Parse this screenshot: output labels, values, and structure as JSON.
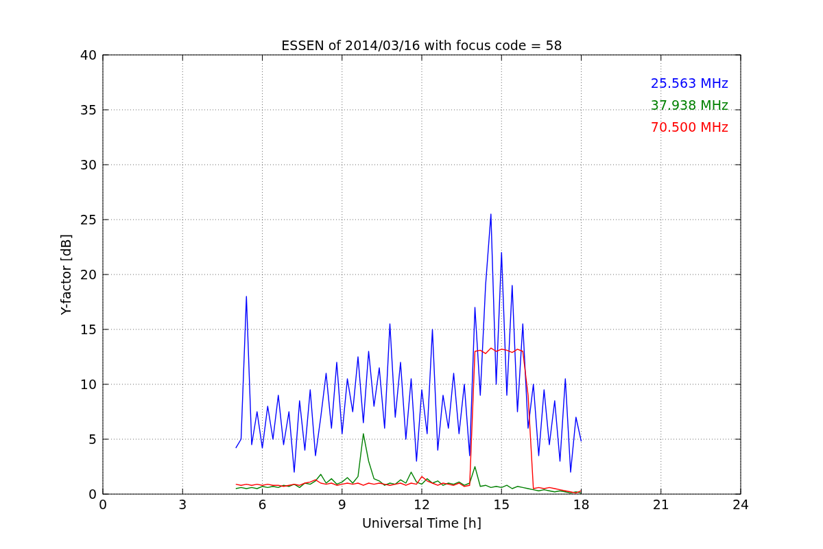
{
  "chart_data": {
    "type": "line",
    "title": "ESSEN of 2014/03/16 with focus code = 58",
    "xlabel": "Universal Time [h]",
    "ylabel": "Y-factor [dB]",
    "x": [
      5.0,
      5.2,
      5.4,
      5.6,
      5.8,
      6.0,
      6.2,
      6.4,
      6.6,
      6.8,
      7.0,
      7.2,
      7.4,
      7.6,
      7.8,
      8.0,
      8.2,
      8.4,
      8.6,
      8.8,
      9.0,
      9.2,
      9.4,
      9.6,
      9.8,
      10.0,
      10.2,
      10.4,
      10.6,
      10.8,
      11.0,
      11.2,
      11.4,
      11.6,
      11.8,
      12.0,
      12.2,
      12.4,
      12.6,
      12.8,
      13.0,
      13.2,
      13.4,
      13.6,
      13.8,
      14.0,
      14.2,
      14.4,
      14.6,
      14.8,
      15.0,
      15.2,
      15.4,
      15.6,
      15.8,
      16.0,
      16.2,
      16.4,
      16.6,
      16.8,
      17.0,
      17.2,
      17.4,
      17.6,
      17.8,
      18.0
    ],
    "series": [
      {
        "name": "25.563 MHz",
        "color": "#0000ff",
        "values": [
          4.2,
          5.0,
          18.0,
          4.5,
          7.5,
          4.2,
          8.0,
          5.0,
          9.0,
          4.5,
          7.5,
          2.0,
          8.5,
          4.0,
          9.5,
          3.5,
          7.0,
          11.0,
          6.0,
          12.0,
          5.5,
          10.5,
          7.5,
          12.5,
          6.5,
          13.0,
          8.0,
          11.5,
          6.0,
          15.5,
          7.0,
          12.0,
          5.0,
          10.5,
          3.0,
          9.5,
          5.5,
          15.0,
          4.0,
          9.0,
          6.0,
          11.0,
          5.5,
          10.0,
          3.5,
          17.0,
          9.0,
          19.0,
          25.5,
          10.0,
          22.0,
          9.0,
          19.0,
          7.5,
          15.5,
          6.0,
          10.0,
          3.5,
          9.5,
          4.5,
          8.5,
          3.0,
          10.5,
          2.0,
          7.0,
          4.8
        ]
      },
      {
        "name": "37.938 MHz",
        "color": "#008000",
        "values": [
          0.5,
          0.6,
          0.5,
          0.6,
          0.5,
          0.7,
          0.6,
          0.7,
          0.6,
          0.8,
          0.7,
          0.9,
          0.6,
          1.0,
          0.9,
          1.2,
          1.8,
          1.0,
          1.4,
          0.9,
          1.1,
          1.5,
          1.0,
          1.6,
          5.5,
          3.0,
          1.4,
          1.2,
          0.8,
          1.0,
          0.9,
          1.3,
          1.0,
          2.0,
          1.1,
          0.9,
          1.4,
          1.0,
          1.2,
          0.8,
          1.0,
          0.9,
          1.1,
          0.8,
          1.0,
          2.5,
          0.7,
          0.8,
          0.6,
          0.7,
          0.6,
          0.8,
          0.5,
          0.7,
          0.6,
          0.5,
          0.4,
          0.3,
          0.4,
          0.3,
          0.2,
          0.3,
          0.2,
          0.1,
          0.2,
          0.1
        ]
      },
      {
        "name": "70.500 MHz",
        "color": "#ff0000",
        "values": [
          0.9,
          0.8,
          0.9,
          0.8,
          0.9,
          0.8,
          0.9,
          0.8,
          0.8,
          0.7,
          0.8,
          0.9,
          0.8,
          1.0,
          1.1,
          1.3,
          1.0,
          0.9,
          1.0,
          0.8,
          0.9,
          1.0,
          0.9,
          1.0,
          0.8,
          1.0,
          0.9,
          1.0,
          0.9,
          0.8,
          0.9,
          1.0,
          0.8,
          1.0,
          0.9,
          1.6,
          1.2,
          1.0,
          0.8,
          1.0,
          0.9,
          0.8,
          1.0,
          0.7,
          0.8,
          13.0,
          13.1,
          12.8,
          13.3,
          13.0,
          13.2,
          13.1,
          12.9,
          13.2,
          13.0,
          9.0,
          0.5,
          0.6,
          0.5,
          0.6,
          0.5,
          0.4,
          0.3,
          0.2,
          0.1,
          0.3
        ]
      }
    ],
    "grid": true,
    "xlim": [
      0,
      24
    ],
    "ylim": [
      0,
      40
    ],
    "xticks": [
      0,
      3,
      6,
      9,
      12,
      15,
      18,
      21,
      24
    ],
    "yticks": [
      0,
      5,
      10,
      15,
      20,
      25,
      30,
      35,
      40
    ]
  }
}
